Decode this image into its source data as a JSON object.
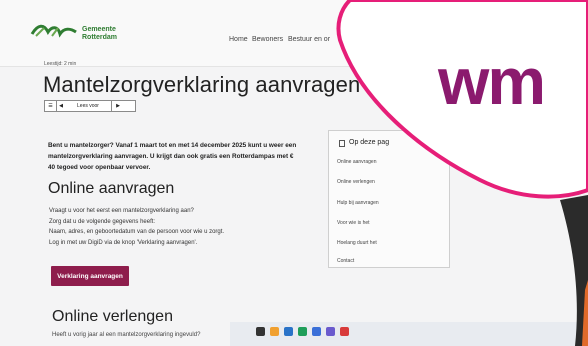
{
  "header": {
    "logo_line1": "Gemeente",
    "logo_line2": "Rotterdam",
    "nav": [
      "Home",
      "Bewoners",
      "Bestuur en or"
    ]
  },
  "page": {
    "reading_time": "Leestijd: 2 min",
    "title": "Mantelzorgverklaring aanvragen",
    "readspeaker_label": "Lees voor",
    "intro": "Bent u mantelzorger? Vanaf 1 maart tot en met 14 december 2025 kunt u weer een mantelzorgverklaring aanvragen. U krijgt dan ook gratis een Rotterdampas met € 40 tegoed voor openbaar vervoer.",
    "apply_heading": "Online aanvragen",
    "apply_lines": [
      "Vraagt u voor het eerst een mantelzorgverklaring aan?",
      "Zorg dat u de volgende gegevens heeft:",
      "Naam, adres, en geboortedatum van de persoon voor wie u zorgt.",
      "Log in met uw DigiD via de knop 'Verklaring aanvragen'."
    ],
    "apply_button": "Verklaring aanvragen",
    "extend_heading": "Online verlengen",
    "extend_text": "Heeft u vorig jaar al een mantelzorgverklaring ingevuld?"
  },
  "toc": {
    "title": "Op deze pag",
    "items": [
      "Online aanvragen",
      "Online verlengen",
      "Hulp bij aanvragen",
      "Voor wie is het",
      "Hoelang duurt het",
      "Contact"
    ]
  },
  "overlay": {
    "logo_text": "wm"
  },
  "colors": {
    "accent_button": "#8e1d4c",
    "overlay_pink": "#e61e78",
    "overlay_purple": "#8b1a6e",
    "logo_green": "#2f7d32"
  }
}
